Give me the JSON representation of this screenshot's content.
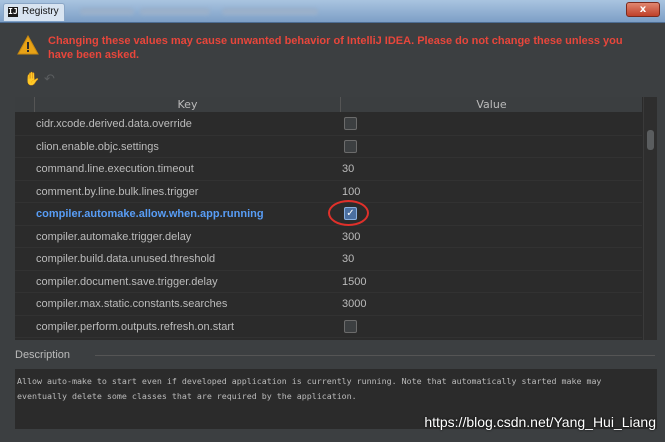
{
  "window": {
    "title": "Registry",
    "app_icon": "intellij-icon",
    "close_label": "x"
  },
  "warning": {
    "icon": "warning-triangle-icon",
    "text": "Changing these values may cause unwanted behavior of IntelliJ IDEA. Please do not change these unless you have been asked.",
    "color": "#e8463b"
  },
  "toolbar": {
    "icons": [
      "restore-icon",
      "revert-icon"
    ]
  },
  "table": {
    "columns": {
      "key": "Key",
      "value": "Value"
    },
    "rows": [
      {
        "key": "cidr.xcode.derived.data.override",
        "type": "checkbox",
        "checked": false
      },
      {
        "key": "clion.enable.objc.settings",
        "type": "checkbox",
        "checked": false
      },
      {
        "key": "command.line.execution.timeout",
        "type": "text",
        "value": "30"
      },
      {
        "key": "comment.by.line.bulk.lines.trigger",
        "type": "text",
        "value": "100"
      },
      {
        "key": "compiler.automake.allow.when.app.running",
        "type": "checkbox",
        "checked": true,
        "modified": true,
        "highlighted": true
      },
      {
        "key": "compiler.automake.trigger.delay",
        "type": "text",
        "value": "300"
      },
      {
        "key": "compiler.build.data.unused.threshold",
        "type": "text",
        "value": "30"
      },
      {
        "key": "compiler.document.save.trigger.delay",
        "type": "text",
        "value": "1500"
      },
      {
        "key": "compiler.max.static.constants.searches",
        "type": "text",
        "value": "3000"
      },
      {
        "key": "compiler.perform.outputs.refresh.on.start",
        "type": "checkbox",
        "checked": false
      }
    ]
  },
  "description": {
    "label": "Description",
    "text": "Allow auto-make to start even if developed application is currently running. Note that automatically started make may eventually delete some classes that are required by the application."
  },
  "watermark": "https://blog.csdn.net/Yang_Hui_Liang",
  "colors": {
    "modified_key": "#589df6",
    "highlight_ring": "#e0302a",
    "background": "#3c3f41"
  }
}
